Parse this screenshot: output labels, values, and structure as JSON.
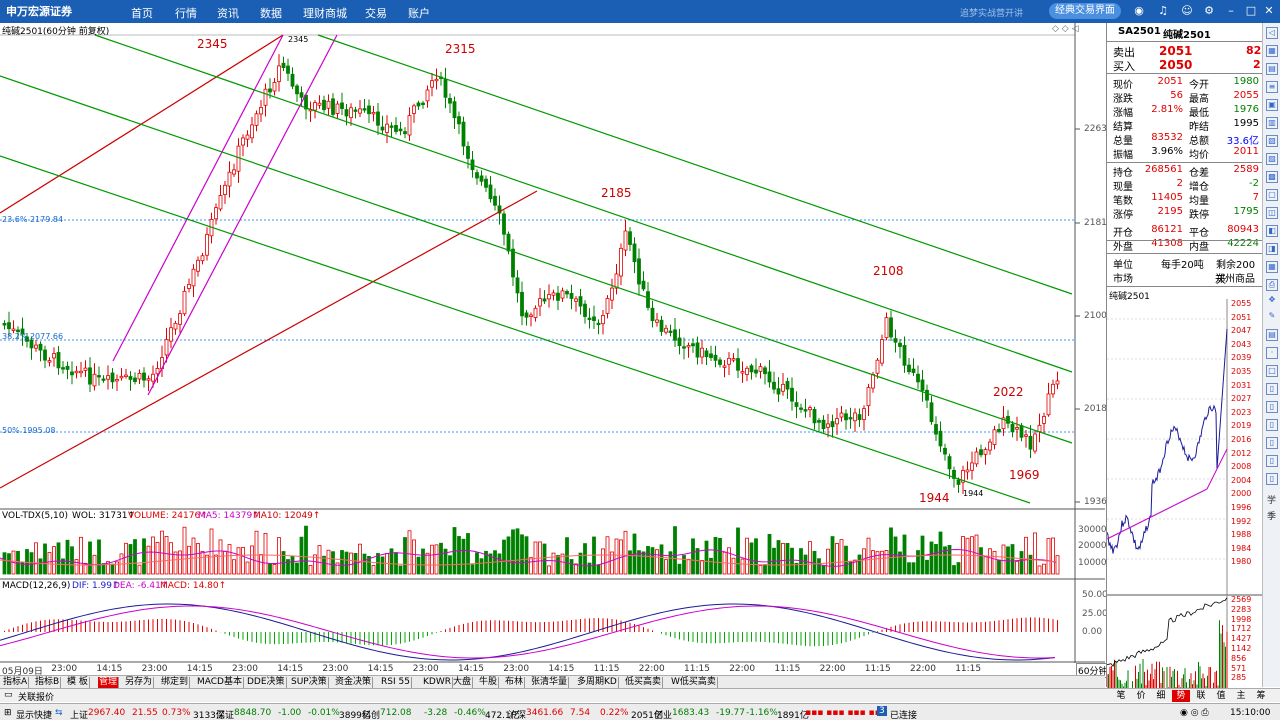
{
  "app": {
    "logo": "申万宏源证券",
    "nav": [
      "首页",
      "行情",
      "资讯",
      "数据",
      "理财商城",
      "交易",
      "账户"
    ],
    "slogan": "追梦实战营开讲",
    "classic_btn": "经典交易界面",
    "window_icons": [
      "search-icon",
      "bell-icon",
      "user-icon",
      "settings-icon",
      "gear-icon",
      "minimize-icon",
      "maximize-icon",
      "close-icon"
    ]
  },
  "chart": {
    "header": "纯碱2501(60分钟 前复权)",
    "price_axis": [
      "2263",
      "2181",
      "2100",
      "2018",
      "1936"
    ],
    "fib": [
      "23.6% 2179.84",
      "38.2% 2077.66",
      "50% 1995.08"
    ],
    "annotations": [
      "2345",
      "2315",
      "2185",
      "2108",
      "2022",
      "1969",
      "1944"
    ],
    "vol_header": {
      "name": "VOL-TDX(5,10)",
      "vol": "WOL: 31731↑",
      "volume": "VOLUME: 24176↑",
      "ma5": "MA5: 14379↑",
      "ma10": "MA10: 12049↑"
    },
    "vol_axis": [
      "30000",
      "20000",
      "10000"
    ],
    "macd_header": {
      "name": "MACD(12,26,9)",
      "dif": "DIF: 1.99↑",
      "dea": "DEA: -6.41↑",
      "macd": "MACD: 14.80↑"
    },
    "macd_axis": [
      "50.00",
      "25.00",
      "0.00"
    ],
    "time_axis": [
      "05月09日",
      "23:00",
      "14:15",
      "23:00",
      "14:15",
      "23:00",
      "14:15",
      "23:00",
      "14:15",
      "23:00",
      "14:15",
      "23:00",
      "14:15",
      "11:15",
      "22:00",
      "11:15",
      "22:00",
      "11:15",
      "22:00",
      "11:15",
      "22:00",
      "11:15"
    ],
    "period": "60分钟"
  },
  "quote": {
    "symbol": "SA2501",
    "name": "纯碱2501",
    "sell_label": "卖出",
    "sell_price": "2051",
    "sell_vol": "82",
    "buy_label": "买入",
    "buy_price": "2050",
    "buy_vol": "2",
    "rows": [
      {
        "l1": "现价",
        "v1": "2051",
        "c1": "red",
        "l2": "今开",
        "v2": "1980",
        "c2": "green"
      },
      {
        "l1": "涨跌",
        "v1": "56",
        "c1": "red",
        "l2": "最高",
        "v2": "2055",
        "c2": "red"
      },
      {
        "l1": "涨幅",
        "v1": "2.81%",
        "c1": "red",
        "l2": "最低",
        "v2": "1976",
        "c2": "green"
      },
      {
        "l1": "结算",
        "v1": "",
        "c1": "black",
        "l2": "昨结",
        "v2": "1995",
        "c2": "black"
      },
      {
        "l1": "总量",
        "v1": "83532",
        "c1": "red",
        "l2": "总额",
        "v2": "33.6亿",
        "c2": "blue"
      },
      {
        "l1": "振幅",
        "v1": "3.96%",
        "c1": "black",
        "l2": "均价",
        "v2": "2011",
        "c2": "red"
      },
      {
        "l1": "持仓",
        "v1": "268561",
        "c1": "red",
        "l2": "仓差",
        "v2": "2589",
        "c2": "red"
      },
      {
        "l1": "现量",
        "v1": "2",
        "c1": "red",
        "l2": "增仓",
        "v2": "-2",
        "c2": "green"
      },
      {
        "l1": "笔数",
        "v1": "11405",
        "c1": "red",
        "l2": "均量",
        "v2": "7",
        "c2": "red"
      },
      {
        "l1": "涨停",
        "v1": "2195",
        "c1": "red",
        "l2": "跌停",
        "v2": "1795",
        "c2": "green"
      },
      {
        "l1": "开仓",
        "v1": "86121",
        "c1": "red",
        "l2": "平仓",
        "v2": "80943",
        "c2": "red"
      },
      {
        "l1": "外盘",
        "v1": "41308",
        "c1": "red",
        "l2": "内盘",
        "v2": "42224",
        "c2": "green"
      }
    ],
    "unit_label": "单位",
    "unit": "每手20吨",
    "remain": "剩余200天",
    "market_label": "市场",
    "market": "郑州商品",
    "mini_title": "纯碱2501",
    "mini_axis": [
      "2055",
      "2051",
      "2047",
      "2043",
      "2039",
      "2035",
      "2031",
      "2027",
      "2023",
      "2019",
      "2016",
      "2012",
      "2008",
      "2004",
      "2000",
      "1996",
      "1992",
      "1988",
      "1984",
      "1980",
      "2569",
      "2283",
      "1998",
      "1712",
      "1427",
      "1142",
      "856",
      "571",
      "285"
    ],
    "right_tabs": [
      "笔",
      "价",
      "细",
      "势",
      "联",
      "值",
      "主",
      "筹"
    ],
    "side_chars": [
      "学",
      "季"
    ]
  },
  "tabs": [
    "指标A",
    "指标B",
    "模 板",
    "管理",
    "另存为",
    "绑定到",
    "MACD基本",
    "DDE决策",
    "SUP决策",
    "资金决策",
    "RSI 55",
    "KDWR",
    "大盘",
    "牛股",
    "布林",
    "张清华量",
    "多周期KD",
    "低买高卖",
    "W低买高卖"
  ],
  "status": {
    "text": "关联报价"
  },
  "ticker": {
    "show": "显示快捷",
    "items": [
      {
        "n": "上证",
        "v": "2967.40",
        "c": "21.55",
        "p": "0.73%",
        "a": "3133亿",
        "col": "red"
      },
      {
        "n": "深证",
        "v": "8848.70",
        "c": "-1.00",
        "p": "-0.01%",
        "a": "3899亿",
        "col": "green"
      },
      {
        "n": "科创",
        "v": "712.08",
        "c": "-3.28",
        "p": "-0.46%",
        "a": "472.1亿",
        "col": "green"
      },
      {
        "n": "沪深",
        "v": "3461.66",
        "c": "7.54",
        "p": "0.22%",
        "a": "2051亿",
        "col": "red"
      },
      {
        "n": "创业",
        "v": "1683.43",
        "c": "-19.77",
        "p": "-1.16%",
        "a": "1891亿",
        "col": "green"
      }
    ],
    "conn": "已连接",
    "time": "15:10:00"
  },
  "colors": {
    "up": "#e00000",
    "down": "#008000",
    "channel": "#009900",
    "support": "#cc0000",
    "purple": "#cc00cc"
  }
}
